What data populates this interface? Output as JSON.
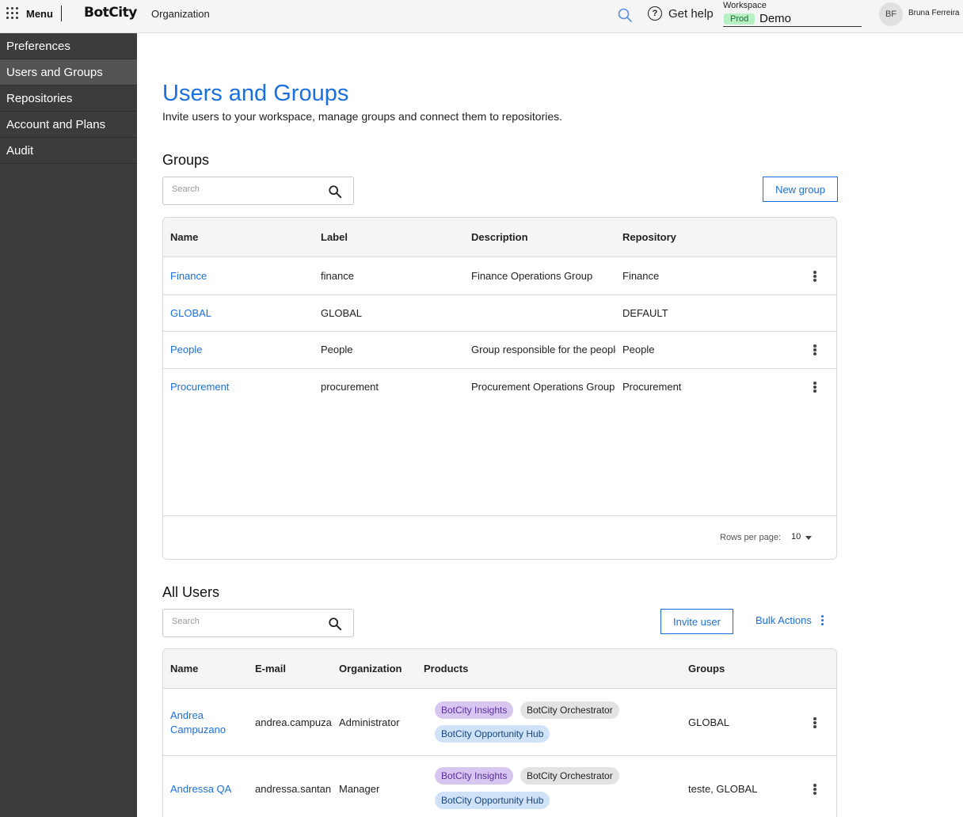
{
  "topbar": {
    "menu_label": "Menu",
    "logo": "BotCity",
    "section": "Organization",
    "help_label": "Get help",
    "workspace_label": "Workspace",
    "workspace_env": "Prod",
    "workspace_name": "Demo",
    "avatar_initials": "BF",
    "user_name": "Bruna Ferreira"
  },
  "sidebar": {
    "items": [
      {
        "label": "Preferences"
      },
      {
        "label": "Users and Groups"
      },
      {
        "label": "Repositories"
      },
      {
        "label": "Account and Plans"
      },
      {
        "label": "Audit"
      }
    ],
    "active": "Users and Groups"
  },
  "page": {
    "title": "Users and Groups",
    "subtitle": "Invite users to your workspace, manage groups and connect them to repositories."
  },
  "groups": {
    "title": "Groups",
    "search_placeholder": "Search",
    "new_button": "New group",
    "columns": [
      "Name",
      "Label",
      "Description",
      "Repository"
    ],
    "rows": [
      {
        "name": "Finance",
        "label": "finance",
        "description": "Finance Operations Group",
        "repository": "Finance"
      },
      {
        "name": "GLOBAL",
        "label": "GLOBAL",
        "description": "",
        "repository": "DEFAULT"
      },
      {
        "name": "People",
        "label": "People",
        "description": "Group responsible for the people",
        "repository": "People"
      },
      {
        "name": "Procurement",
        "label": "procurement",
        "description": "Procurement Operations Group",
        "repository": "Procurement"
      }
    ],
    "rows_per_page_label": "Rows per page:",
    "rows_per_page": "10"
  },
  "users": {
    "title": "All Users",
    "search_placeholder": "Search",
    "invite_button": "Invite user",
    "bulk_actions": "Bulk Actions",
    "columns": [
      "Name",
      "E-mail",
      "Organization",
      "Products",
      "Groups"
    ],
    "rows": [
      {
        "name_line1": "Andrea",
        "name_line2": "Campuzano",
        "email": "andrea.campuza",
        "organization": "Administrator",
        "products": [
          "BotCity Insights",
          "BotCity Orchestrator",
          "BotCity Opportunity Hub"
        ],
        "groups": "GLOBAL"
      },
      {
        "name_line1": "Andressa QA",
        "name_line2": "",
        "email": "andressa.santan",
        "organization": "Manager",
        "products": [
          "BotCity Insights",
          "BotCity Orchestrator",
          "BotCity Opportunity Hub"
        ],
        "groups": "teste, GLOBAL"
      }
    ]
  },
  "colors": {
    "accent": "#1a6fdf",
    "sidebar_bg": "#3c3c3c",
    "sidebar_active": "#545454",
    "prod_badge": "#b7f0c4"
  }
}
